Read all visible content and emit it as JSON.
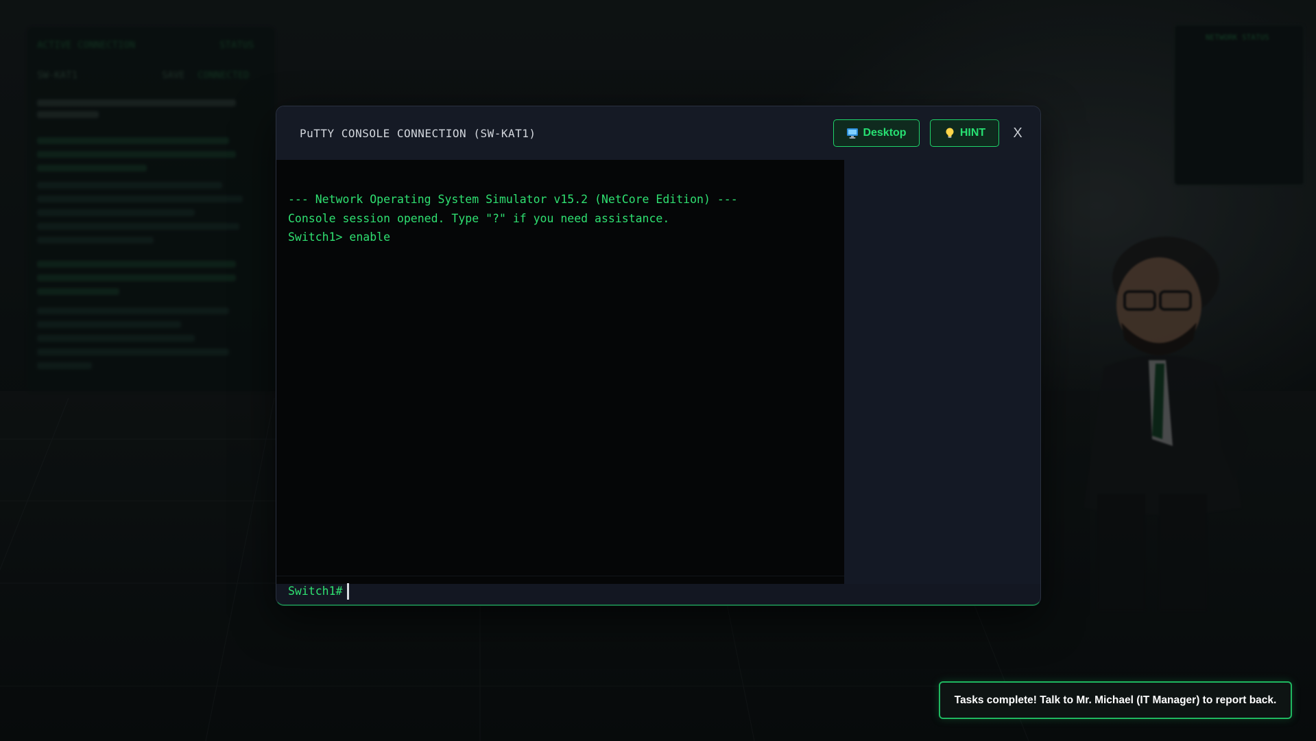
{
  "background": {
    "left_panel": {
      "header_left": "ACTIVE CONNECTION",
      "header_right": "STATUS",
      "device": "SW-KAT1",
      "state_prefix": "SAVE",
      "state": "CONNECTED"
    },
    "right_panel": {
      "title": "NETWORK STATUS"
    }
  },
  "console": {
    "title": "PuTTY CONSOLE CONNECTION (SW-KAT1)",
    "desktop_label": "Desktop",
    "desktop_icon": "monitor-icon",
    "hint_label": "HINT",
    "hint_icon": "lightbulb-icon",
    "close_label": "X",
    "output_lines": [
      "--- Network Operating System Simulator v15.2 (NetCore Edition) ---",
      "Console session opened. Type \"?\" if you need assistance.",
      "Switch1> enable"
    ],
    "prompt": "Switch1#",
    "input_value": ""
  },
  "toast": {
    "message": "Tasks complete! Talk to Mr. Michael (IT Manager) to report back."
  },
  "colors": {
    "terminal_green": "#2fe071",
    "accent_green": "#1fd56a",
    "window_bg": "#131722",
    "terminal_bg": "#050607"
  }
}
